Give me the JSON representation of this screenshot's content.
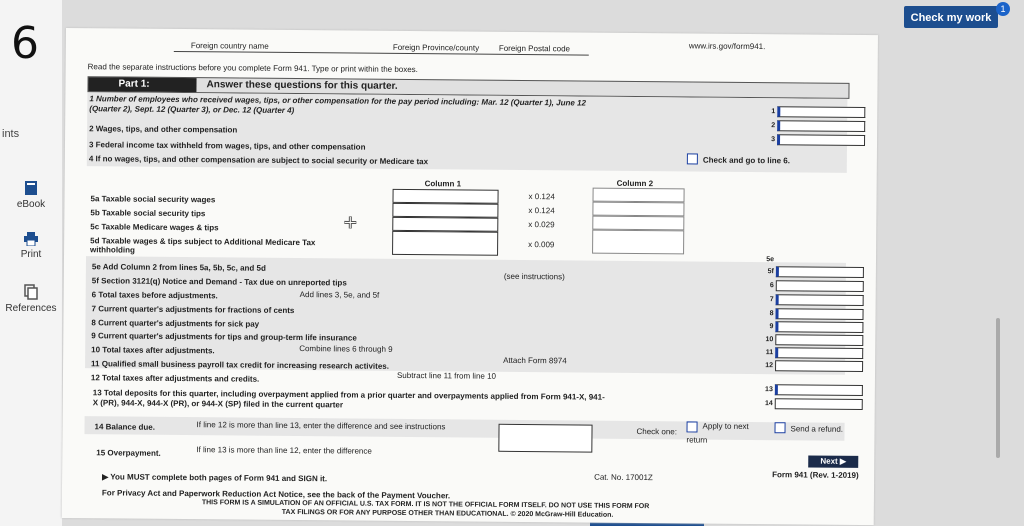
{
  "question_number": "6",
  "sidebar": {
    "ints": "ints",
    "ebook": "eBook",
    "print": "Print",
    "references": "References"
  },
  "topbar": {
    "check_my_work": "Check my work",
    "badge": "1"
  },
  "form": {
    "url": "www.irs.gov/form941.",
    "foreign_country": "Foreign country name",
    "foreign_province": "Foreign Province/county",
    "foreign_postal": "Foreign Postal code",
    "instructions": "Read the separate instructions before you complete Form 941.  Type or print within the boxes.",
    "part1_label": "Part 1:",
    "part1_title": "Answer these questions for this quarter.",
    "line1": "1  Number of employees who received wages, tips, or other compensation for the pay period including:  Mar. 12 (Quarter 1), June 12",
    "line1b": "(Quarter 2), Sept. 12 (Quarter 3), or Dec. 12 (Quarter 4)",
    "line2": "2  Wages, tips, and other compensation",
    "line3": "3  Federal income tax withheld from wages, tips, and other compensation",
    "line4": "4  If no wages, tips, and other compensation are subject to social security or Medicare tax",
    "line4_check": "Check and go to line 6.",
    "column1": "Column 1",
    "column2": "Column 2",
    "line5a": "5a Taxable social security wages",
    "line5b": "5b Taxable social security tips",
    "line5c": "5c Taxable Medicare wages & tips",
    "line5d": "5d Taxable wages & tips subject to Additional Medicare Tax",
    "line5d_b": "withholding",
    "rate_5a": "x  0.124",
    "rate_5b": "x  0.124",
    "rate_5c": "x  0.029",
    "rate_5d": "x  0.009",
    "line5e": "5e Add Column 2 from lines 5a, 5b, 5c, and 5d",
    "line5f": "5f Section 3121(q) Notice and Demand - Tax due on unreported tips",
    "see_instructions": "(see instructions)",
    "line6": "6  Total taxes before adjustments.",
    "line6_note": "Add lines 3, 5e, and 5f",
    "line7": "7  Current quarter's adjustments for fractions of cents",
    "line8": "8  Current quarter's adjustments for sick pay",
    "line9": "9  Current quarter's adjustments for tips and group-term life insurance",
    "line10": "10 Total taxes after adjustments.",
    "line10_note": "Combine lines 6 through 9",
    "line11": "11 Qualified small business payroll tax credit for increasing research activites.",
    "line11_note": "Attach Form 8974",
    "line12": "12 Total taxes after adjustments and credits.",
    "line12_note": "Subtract line 11 from line 10",
    "line13": "13 Total deposits for this quarter, including overpayment applied from a prior quarter and overpayments applied from Form 941-X, 941-",
    "line13b": "X (PR), 944-X, 944-X (PR), or 944-X (SP) filed in the current quarter",
    "line14": "14 Balance due.",
    "line14_note": "If line 12 is more than line 13, enter the difference and see instructions",
    "line15": "15 Overpayment.",
    "line15_note": "If line 13 is more than line 12, enter the difference",
    "check_one": "Check one:",
    "apply_next": "Apply to next",
    "return": "return",
    "send_refund": "Send a refund.",
    "next": "Next",
    "must_complete": "You MUST complete both pages of Form 941 and SIGN it.",
    "privacy": "For Privacy Act and Paperwork Reduction Act Notice, see the back of the Payment Voucher.",
    "cat_no": "Cat. No. 17001Z",
    "form_rev": "Form 941 (Rev. 1-2019)",
    "simulation": "THIS FORM IS A SIMULATION OF AN OFFICIAL U.S. TAX FORM. IT IS NOT THE OFFICIAL FORM ITSELF. DO NOT USE THIS FORM FOR",
    "simulation2": "TAX FILINGS OR FOR ANY PURPOSE OTHER THAN EDUCATIONAL.  © 2020 McGraw-Hill Education."
  },
  "row_numbers": [
    "1",
    "2",
    "3",
    "5e",
    "5f",
    "6",
    "7",
    "8",
    "9",
    "10",
    "11",
    "12",
    "13",
    "14"
  ],
  "colors": {
    "button": "#1d4e8f",
    "badge": "#1b63c9",
    "field_border": "#1b3fa0"
  }
}
